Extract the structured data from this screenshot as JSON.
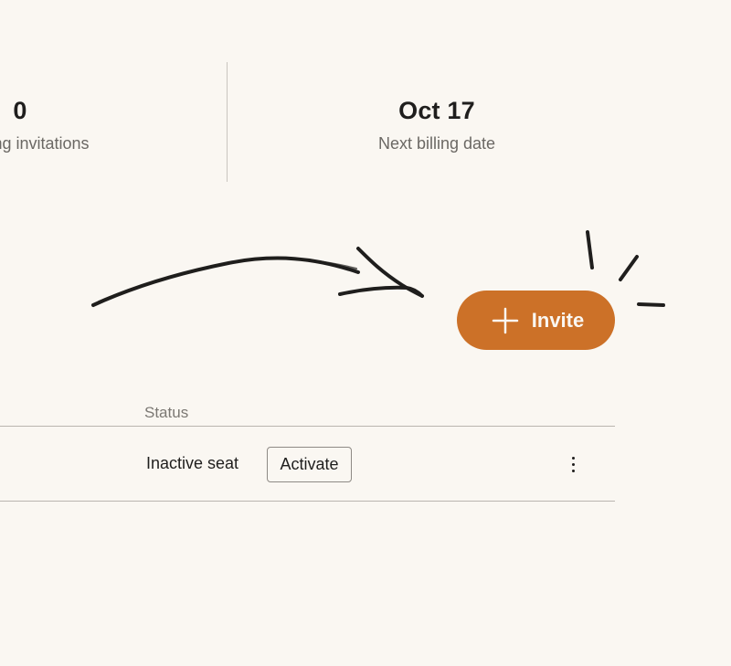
{
  "stats": [
    {
      "value": "0",
      "label": "Pending invitations"
    },
    {
      "value": "Oct 17",
      "label": "Next billing date"
    }
  ],
  "invite_button": {
    "label": "Invite",
    "icon": "plus-icon",
    "color": "#cc7128"
  },
  "table": {
    "headers": {
      "status": "Status"
    },
    "rows": [
      {
        "status": "Inactive seat",
        "action_label": "Activate",
        "menu_icon": "more-vertical-icon"
      }
    ]
  },
  "colors": {
    "background": "#faf7f2",
    "accent": "#cc7128",
    "text": "#1f1e1d",
    "muted_text": "#6b6864"
  }
}
